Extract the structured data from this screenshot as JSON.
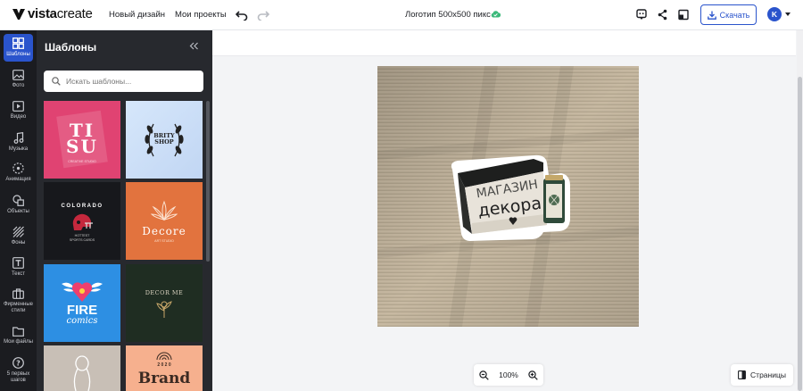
{
  "brand": {
    "bold": "vista",
    "light": "create"
  },
  "nav": {
    "new_design": "Новый дизайн",
    "my_projects": "Мои проекты"
  },
  "document": {
    "title": "Логотип 500x500  пикс"
  },
  "download": {
    "label": "Скачать"
  },
  "user": {
    "initial": "K"
  },
  "rail": [
    {
      "label": "Шаблоны",
      "icon": "templates-icon"
    },
    {
      "label": "Фото",
      "icon": "photo-icon"
    },
    {
      "label": "Видео",
      "icon": "video-icon"
    },
    {
      "label": "Музыка",
      "icon": "music-icon"
    },
    {
      "label": "Анимация",
      "icon": "animation-icon"
    },
    {
      "label": "Объекты",
      "icon": "objects-icon"
    },
    {
      "label": "Фоны",
      "icon": "backgrounds-icon"
    },
    {
      "label": "Текст",
      "icon": "text-icon"
    },
    {
      "label": "Фирменные стили",
      "icon": "brand-kit-icon"
    },
    {
      "label": "Мои файлы",
      "icon": "folder-icon"
    },
    {
      "label": "5 первых шагов",
      "icon": "help-icon"
    }
  ],
  "panel": {
    "title": "Шаблоны",
    "search_placeholder": "Искать шаблоны..."
  },
  "templates": {
    "t1": {
      "line1": "TI",
      "line2": "SU",
      "sub": "CREATIVE STUDIO"
    },
    "t2": {
      "line1": "BRITY",
      "line2": "SHOP"
    },
    "t3": {
      "arc": "COLORADO",
      "sub1": "HOTTEST",
      "sub2": "SPORTS CARDS"
    },
    "t4": {
      "name": "Decore",
      "sub": "ART STUDIO"
    },
    "t5": {
      "line1": "FIRE",
      "line2": "comics"
    },
    "t6": {
      "name": "DECOR ME"
    },
    "t8": {
      "year": "2 0   2 0",
      "name": "Brand"
    }
  },
  "artwork": {
    "line1": "МАГАЗИН",
    "line2": "декора"
  },
  "zoom": {
    "level": "100%"
  },
  "pages": {
    "label": "Страницы"
  },
  "colors": {
    "accent": "#2a54cc",
    "rail_bg": "#1b1c20",
    "panel_bg": "#27292e",
    "cloud": "#3bb97a"
  }
}
